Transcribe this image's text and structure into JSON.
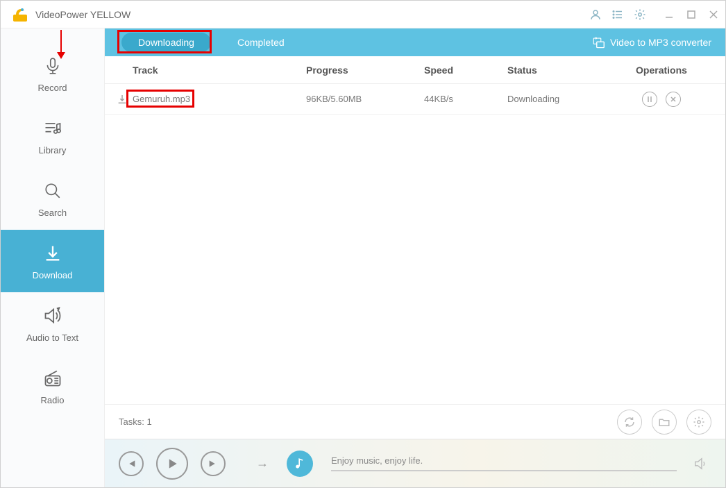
{
  "titlebar": {
    "app_name": "VideoPower YELLOW"
  },
  "sidebar": {
    "items": [
      {
        "label": "Record"
      },
      {
        "label": "Library"
      },
      {
        "label": "Search"
      },
      {
        "label": "Download"
      },
      {
        "label": "Audio to Text"
      },
      {
        "label": "Radio"
      }
    ]
  },
  "tabs": {
    "downloading": "Downloading",
    "completed": "Completed",
    "converter": "Video to MP3 converter"
  },
  "table": {
    "headers": {
      "track": "Track",
      "progress": "Progress",
      "speed": "Speed",
      "status": "Status",
      "operations": "Operations"
    },
    "rows": [
      {
        "track": "Gemuruh.mp3",
        "progress": "96KB/5.60MB",
        "speed": "44KB/s",
        "status": "Downloading"
      }
    ]
  },
  "footer": {
    "tasks_label": "Tasks: 1"
  },
  "player": {
    "message": "Enjoy music, enjoy life."
  }
}
